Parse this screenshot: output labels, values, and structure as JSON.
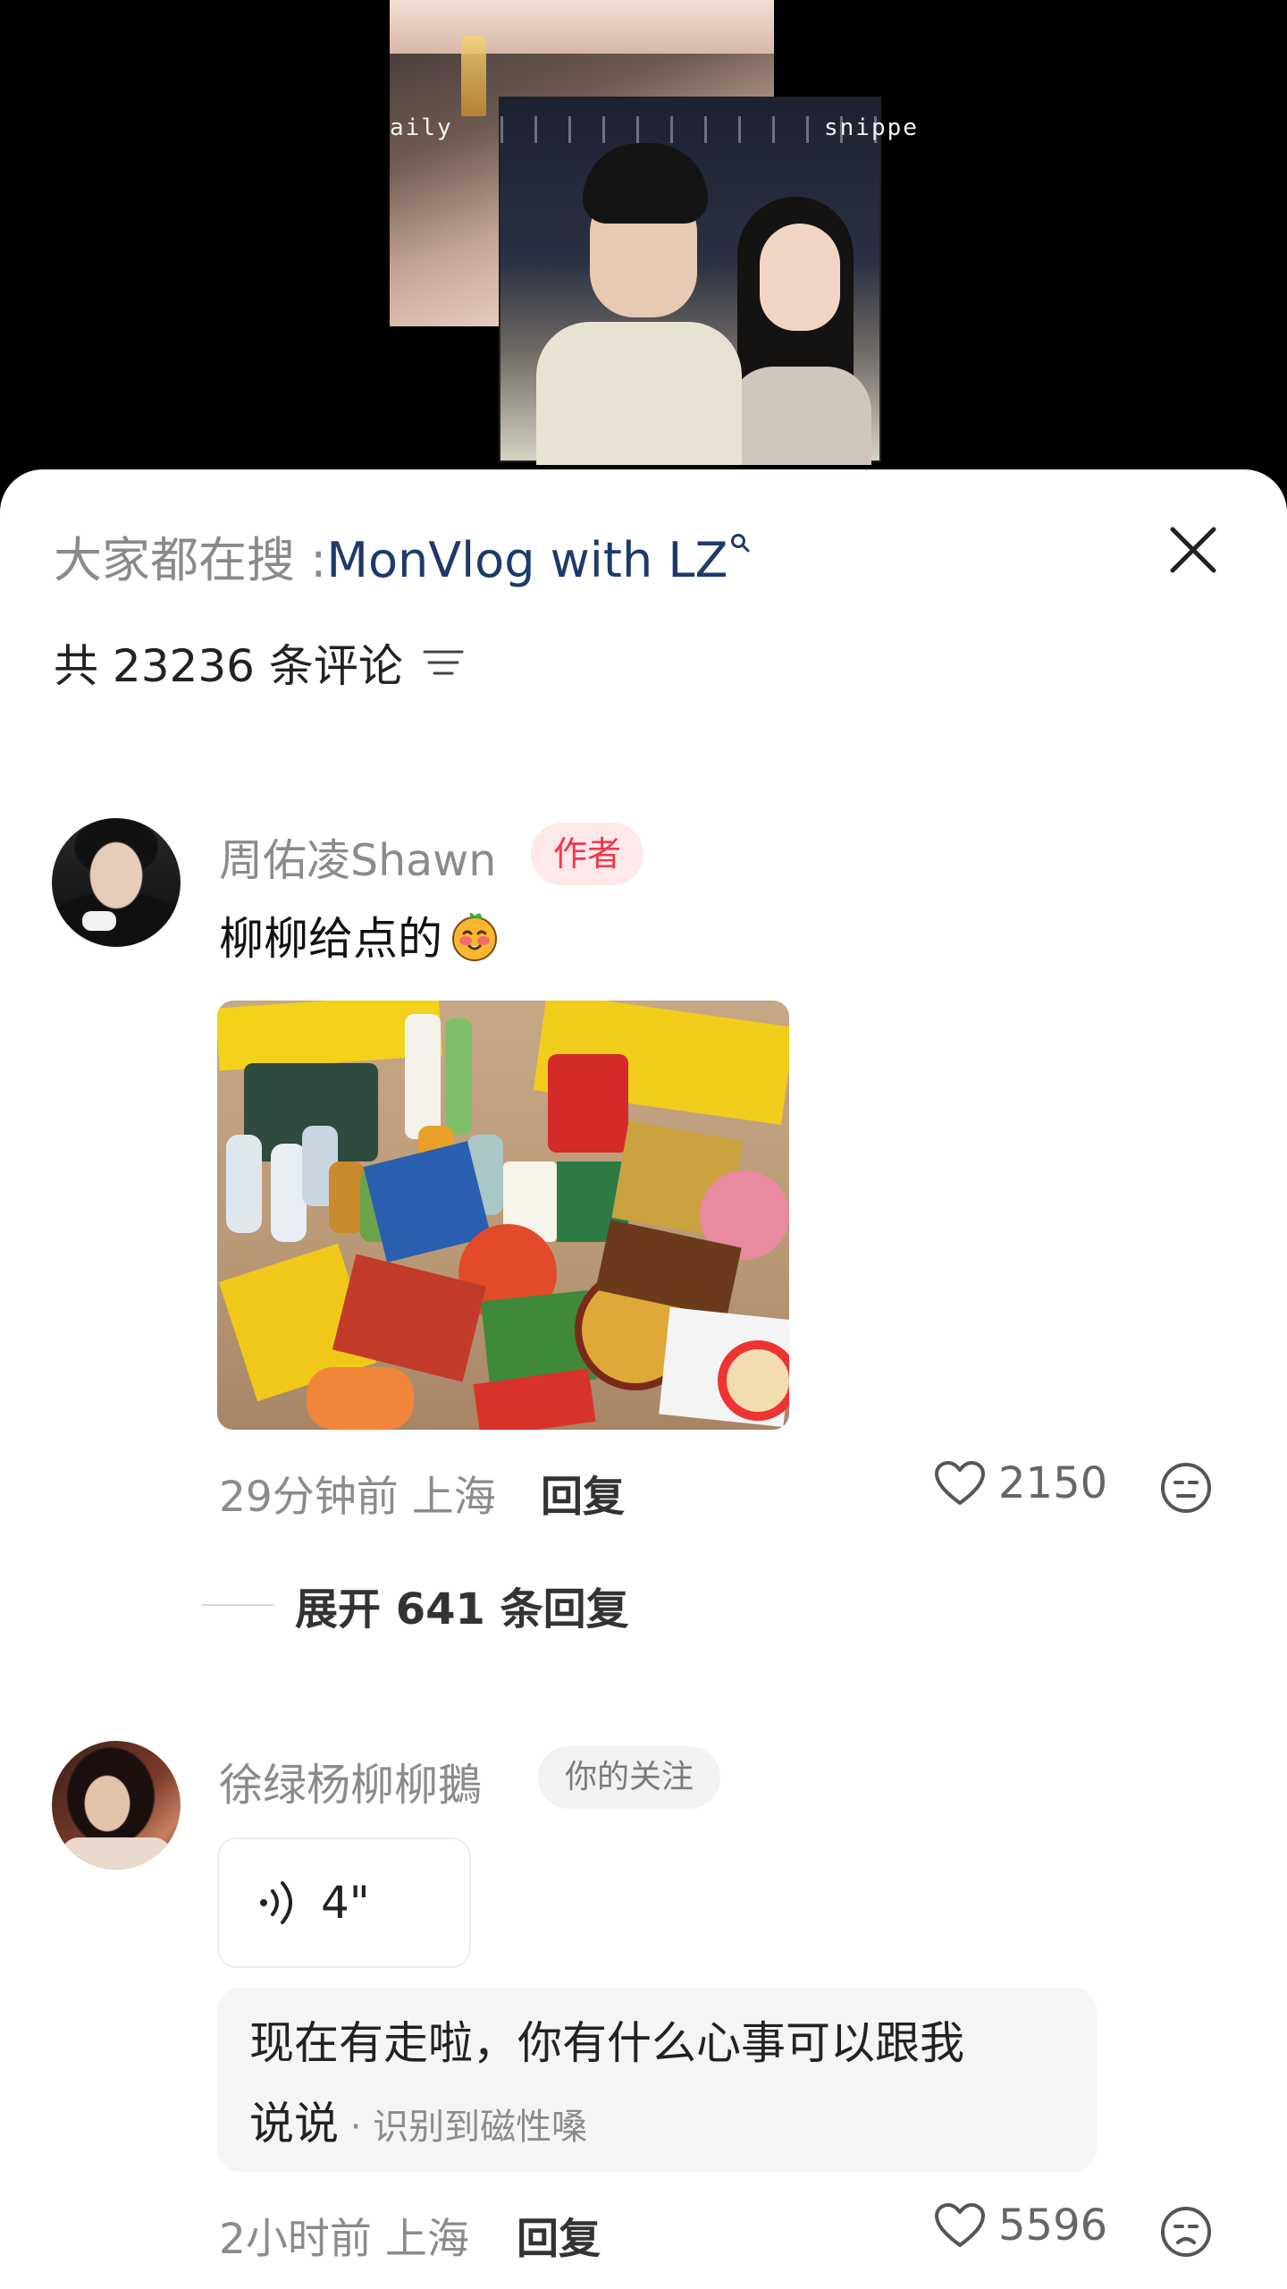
{
  "video": {
    "caption_left": "aily",
    "caption_right": "snippe"
  },
  "header": {
    "search_prefix": "大家都在搜 : ",
    "search_term": "MonVlog with LZ",
    "comment_count": "共 23236 条评论"
  },
  "icons": {
    "close": "close-icon",
    "sort": "sort-lines-icon",
    "search": "search-icon",
    "like": "heart-icon",
    "dislike": "dislike-face-icon",
    "voice": "sound-wave-icon"
  },
  "comments": [
    {
      "author": "周佑凌Shawn",
      "badge": "作者",
      "text": "柳柳给点的",
      "time": "29分钟前",
      "location": "上海",
      "reply_label": "回复",
      "likes": "2150",
      "expand_label": "展开 641 条回复"
    },
    {
      "author": "徐绿杨柳柳鵝",
      "badge": "你的关注",
      "voice_duration": "4\"",
      "transcript_line1": "现在有走啦，你有什么心事可以跟我",
      "transcript_line2": "说说",
      "transcript_hint": " · 识别到磁性嗓",
      "time": "2小时前",
      "location": "上海",
      "reply_label": "回复",
      "likes": "5596"
    }
  ],
  "colors": {
    "author_badge_bg": "#fde8ea",
    "author_badge_text": "#f0384a",
    "search_term": "#1d3a6b"
  }
}
